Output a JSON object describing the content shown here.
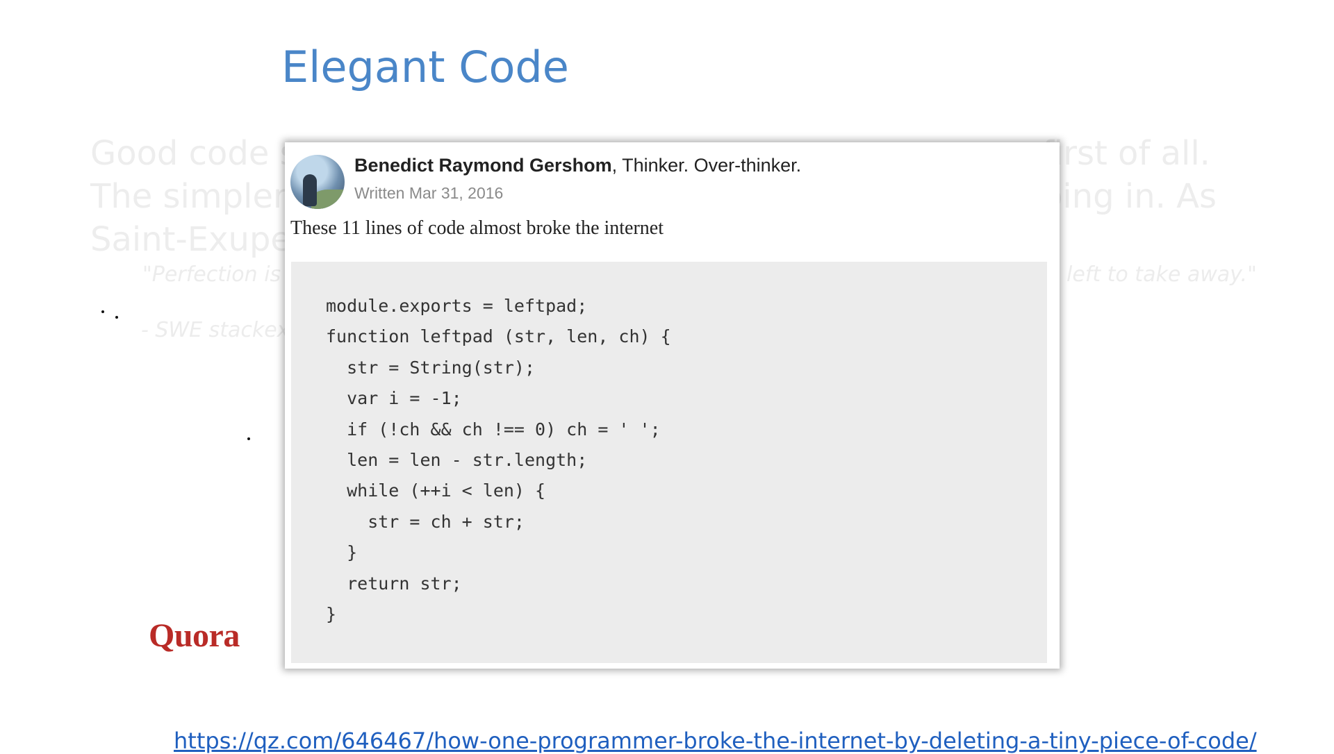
{
  "slide": {
    "title": "Elegant Code",
    "background_text": {
      "line1_left": "Good code s",
      "line1_right": "first of all.",
      "line2_left": "The simpler",
      "line2_right": "oing in.  As",
      "line3_left": "Saint-Exupe",
      "quote_left": "\"Perfection is",
      "quote_right": "left to take away.\"",
      "attribution": "- SWE stackex"
    },
    "source_link": "https://qz.com/646467/how-one-programmer-broke-the-internet-by-deleting-a-tiny-piece-of-code/"
  },
  "post": {
    "author_name": "Benedict Raymond Gershom",
    "author_tagline": ", Thinker. Over-thinker.",
    "written": "Written Mar 31, 2016",
    "title": "These 11 lines of code almost broke the internet",
    "code_lines": [
      "module.exports = leftpad;",
      "function leftpad (str, len, ch) {",
      "  str = String(str);",
      "  var i = -1;",
      "  if (!ch && ch !== 0) ch = ' ';",
      "  len = len - str.length;",
      "  while (++i < len) {",
      "    str = ch + str;",
      "  }",
      "  return str;",
      "}"
    ]
  },
  "quora_logo": "Quora",
  "colors": {
    "title": "#4a86c8",
    "quora_brand": "#b92b27",
    "link": "#1f5fbf",
    "code_background": "#ececec"
  }
}
